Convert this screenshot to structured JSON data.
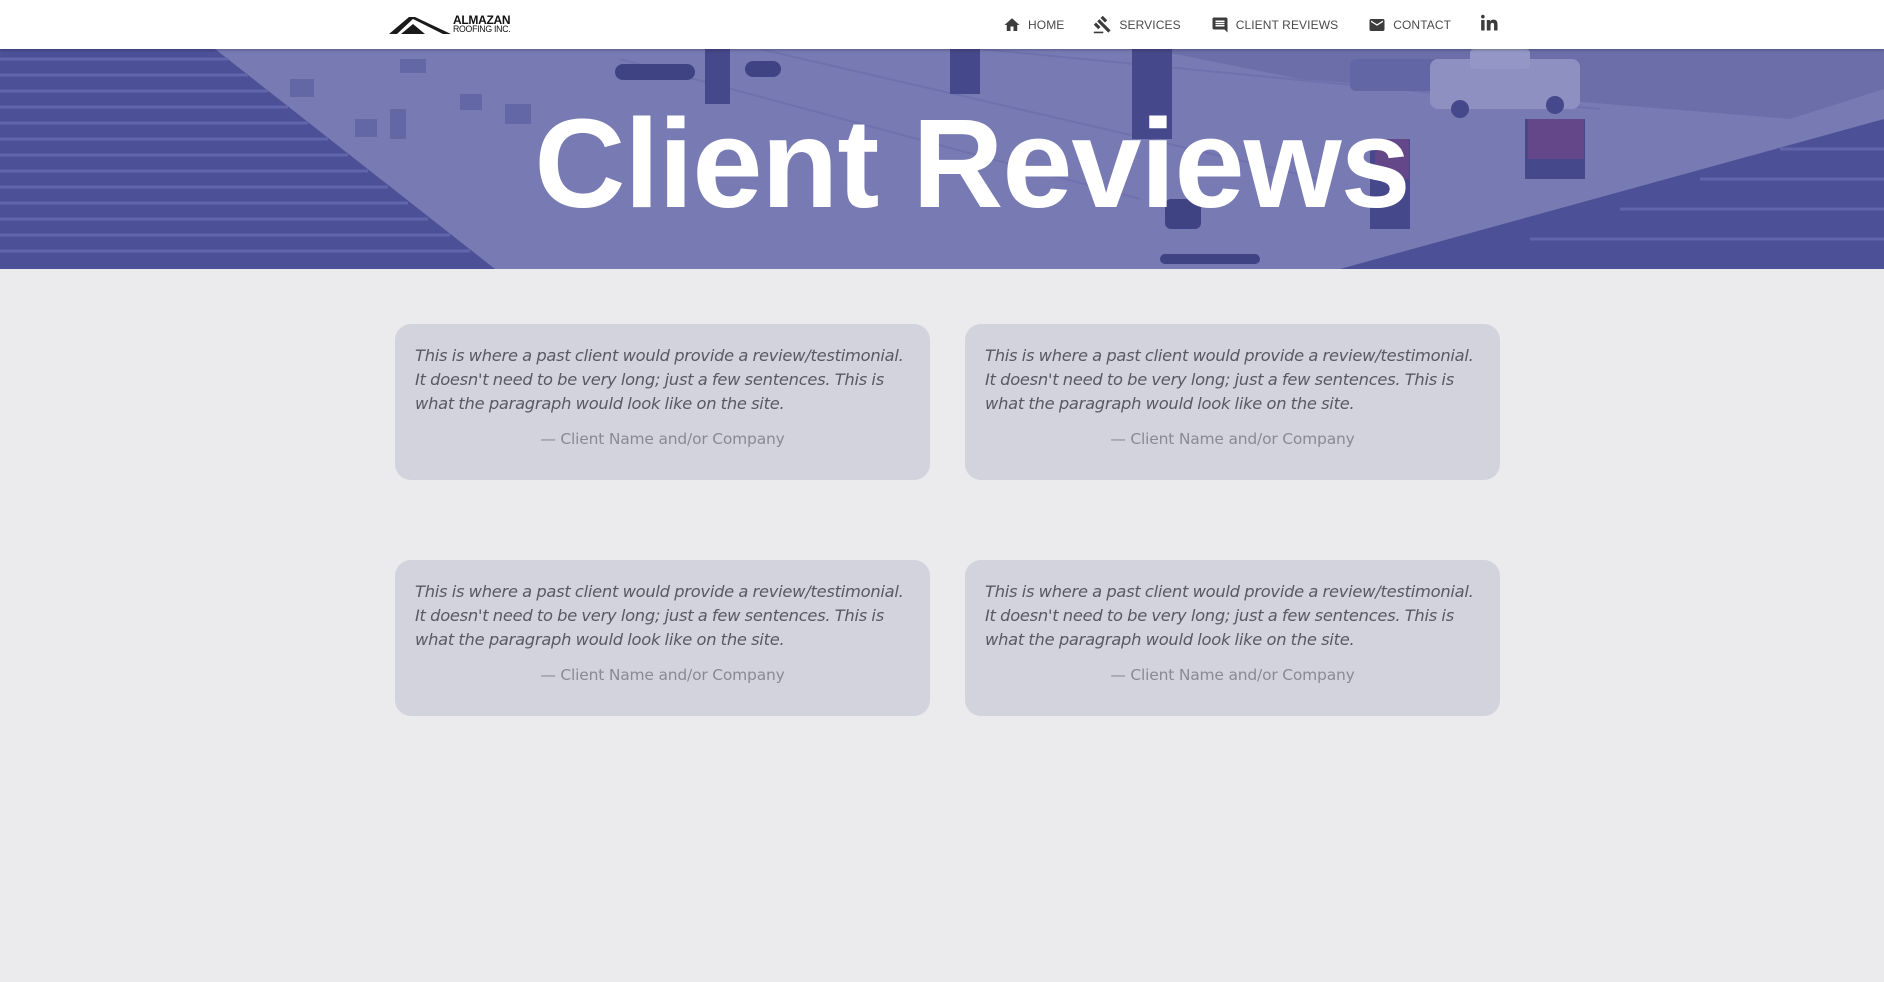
{
  "nav": {
    "logo_line1": "ALMAZAN",
    "logo_line2": "ROOFING INC.",
    "items": [
      {
        "label": "HOME",
        "icon": "home-icon"
      },
      {
        "label": "SERVICES",
        "icon": "gavel-icon"
      },
      {
        "label": "CLIENT REVIEWS",
        "icon": "comment-icon"
      },
      {
        "label": "CONTACT",
        "icon": "mail-icon"
      }
    ],
    "social_icon": "linkedin-icon"
  },
  "hero": {
    "title": "Client Reviews",
    "overlay_color": "#4e52a0"
  },
  "reviews": [
    {
      "quote": "This is where a past client would provide a review/testimonial. It doesn't need to be very long; just a few sentences. This is what the paragraph would look like on the site.",
      "author": "— Client Name and/or Company"
    },
    {
      "quote": "This is where a past client would provide a review/testimonial. It doesn't need to be very long; just a few sentences. This is what the paragraph would look like on the site.",
      "author": "— Client Name and/or Company"
    },
    {
      "quote": "This is where a past client would provide a review/testimonial. It doesn't need to be very long; just a few sentences. This is what the paragraph would look like on the site.",
      "author": "— Client Name and/or Company"
    },
    {
      "quote": "This is where a past client would provide a review/testimonial. It doesn't need to be very long; just a few sentences. This is what the paragraph would look like on the site.",
      "author": "— Client Name and/or Company"
    }
  ],
  "colors": {
    "page_bg": "#ebebee",
    "card_bg": "#d3d3de",
    "nav_bg": "#ffffff"
  }
}
